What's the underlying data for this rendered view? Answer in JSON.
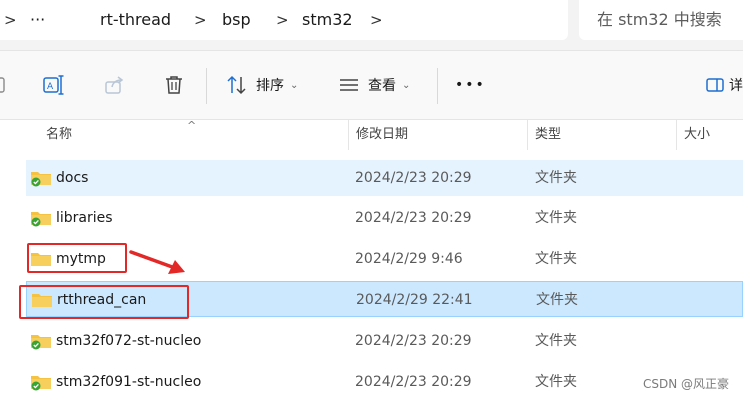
{
  "breadcrumb": {
    "more": "···",
    "items": [
      "rt-thread",
      "bsp",
      "stm32"
    ],
    "separator": ">"
  },
  "search": {
    "placeholder": "在 stm32 中搜索"
  },
  "toolbar": {
    "sort_label": "排序",
    "view_label": "查看",
    "more": "•••",
    "details_label": "详"
  },
  "columns": {
    "name": "名称",
    "modified": "修改日期",
    "type": "类型",
    "size": "大小"
  },
  "files": [
    {
      "name": "docs",
      "modified": "2024/2/23 20:29",
      "type": "文件夹",
      "synced": true
    },
    {
      "name": "libraries",
      "modified": "2024/2/23 20:29",
      "type": "文件夹",
      "synced": true
    },
    {
      "name": "mytmp",
      "modified": "2024/2/29 9:46",
      "type": "文件夹",
      "synced": false
    },
    {
      "name": "rtthread_can",
      "modified": "2024/2/29 22:41",
      "type": "文件夹",
      "synced": false
    },
    {
      "name": "stm32f072-st-nucleo",
      "modified": "2024/2/23 20:29",
      "type": "文件夹",
      "synced": true
    },
    {
      "name": "stm32f091-st-nucleo",
      "modified": "2024/2/23 20:29",
      "type": "文件夹",
      "synced": true
    }
  ],
  "watermark": "CSDN @风正豪",
  "colors": {
    "selection": "#cce8ff",
    "hover": "#e5f3ff",
    "annotation_red": "#e32828",
    "folder": "#f5c242",
    "sync_green": "#3aa335"
  }
}
